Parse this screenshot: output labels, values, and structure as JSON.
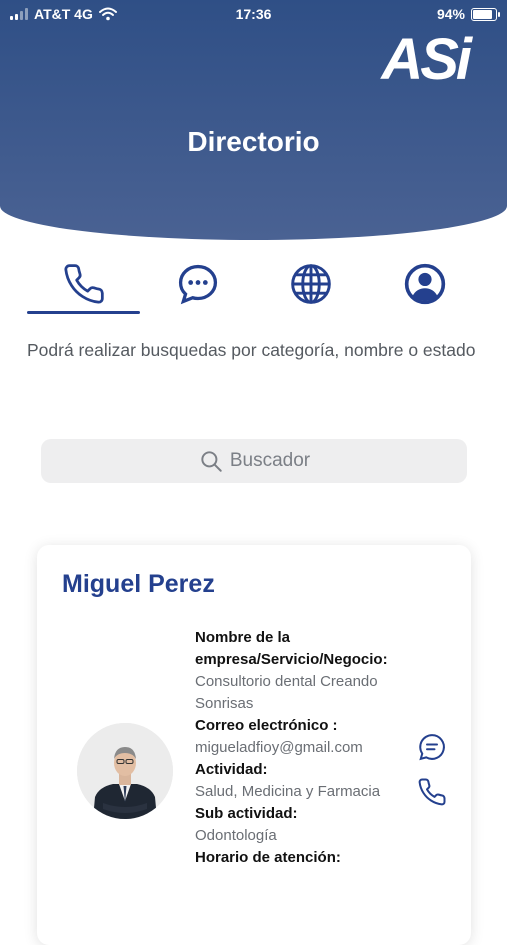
{
  "status_bar": {
    "carrier": "AT&T 4G",
    "time": "17:36",
    "battery_text": "94%",
    "battery_level": 0.94
  },
  "header": {
    "logo_text": "ASi",
    "title": "Directorio"
  },
  "tabs": {
    "selected": "phone",
    "items": [
      {
        "icon": "phone-icon"
      },
      {
        "icon": "chat-bubble-icon"
      },
      {
        "icon": "globe-icon"
      },
      {
        "icon": "user-circle-icon"
      }
    ]
  },
  "description": "Podrá realizar busquedas por categoría, nombre o estado",
  "search": {
    "placeholder": "Buscador"
  },
  "card": {
    "name": "Miguel Perez",
    "company_label": "Nombre de la empresa/Servicio/Negocio:",
    "company_value": "Consultorio dental Creando Sonrisas",
    "email_label": "Correo electrónico :",
    "email_value": "migueladfioy@gmail.com",
    "activity_label": "Actividad:",
    "activity_value": "Salud, Medicina y Farmacia",
    "subactivity_label": "Sub actividad:",
    "subactivity_value": "Odontología",
    "hours_label": "Horario de atención:"
  },
  "colors": {
    "header_top": "#2f4f86",
    "header_bottom": "#4a6293",
    "accent": "#24408e"
  }
}
